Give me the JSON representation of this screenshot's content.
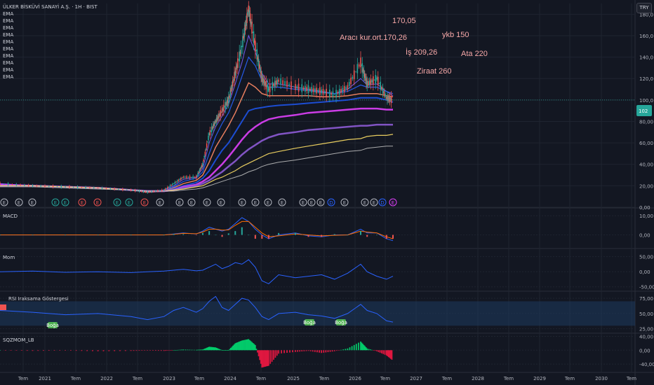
{
  "symbol_title": "ÜLKER BİSKÜVİ SANAYİ A.Ş. · 1H · BIST",
  "currency_button": "TRY",
  "ema_labels": [
    "EMA",
    "EMA",
    "EMA",
    "EMA",
    "EMA",
    "EMA",
    "EMA",
    "EMA",
    "EMA",
    "EMA"
  ],
  "panels": {
    "macd_title": "MACD",
    "mom_title": "Mom",
    "rsi_title": "RSI Iraksama Göstergesi",
    "sqz_title": "SQZMOM_LB"
  },
  "annotations": [
    {
      "id": "a1",
      "text": "170,05"
    },
    {
      "id": "a2",
      "text": "Aracı kur.ort.170,26"
    },
    {
      "id": "a3",
      "text": "ykb 150"
    },
    {
      "id": "a4",
      "text": "İş 209,26"
    },
    {
      "id": "a5",
      "text": "Ata 220"
    },
    {
      "id": "a6",
      "text": "Ziraat 260"
    }
  ],
  "price_badge": "102",
  "rsi_bull_labels": [
    "Boğa",
    "Boğa",
    "Boğa"
  ],
  "rsi_badge": "",
  "colors": {
    "background": "#131722",
    "grid": "#1f2430",
    "macd": "#2962ff",
    "signal": "#ff6d00",
    "momentum": "#2962ff",
    "rsi": "#2962ff",
    "rsi_band": "#1e3a5f",
    "sqz_up": "#00e676",
    "sqz_down": "#ff1744",
    "candle_up": "#26a69a",
    "candle_down": "#ef5350",
    "badge": "#26a69a"
  },
  "chart_data": [
    {
      "type": "line",
      "title": "ÜLKER BİSKÜVİ SANAYİ A.Ş. · 1H · BIST",
      "y_ticks": [
        "0,00",
        "20,00",
        "40,00",
        "60,00",
        "80,00",
        "100,0",
        "120,0",
        "140,0",
        "160,0",
        "180,0"
      ],
      "ylim": [
        0,
        190
      ],
      "x_ticks": [
        "Tem",
        "2021",
        "Tem",
        "2022",
        "Tem",
        "2023",
        "Tem",
        "2024",
        "Tem",
        "2025",
        "Tem",
        "2026",
        "Tem",
        "2027",
        "Tem",
        "2028",
        "Tem",
        "2029",
        "Tem",
        "2030",
        "Tem"
      ],
      "x": [
        2020.5,
        2021.0,
        2021.5,
        2022.0,
        2022.5,
        2022.75,
        2023.0,
        2023.15,
        2023.3,
        2023.5,
        2023.6,
        2023.7,
        2023.8,
        2023.9,
        2024.0,
        2024.1,
        2024.2,
        2024.3,
        2024.4,
        2024.5,
        2024.6,
        2024.75,
        2025.0,
        2025.2,
        2025.4,
        2025.6,
        2025.8,
        2026.0,
        2026.1,
        2026.25,
        2026.4,
        2026.5
      ],
      "series": [
        {
          "role": "price",
          "values": [
            22,
            20,
            19,
            18,
            16,
            14,
            16,
            22,
            28,
            28,
            40,
            68,
            80,
            90,
            100,
            125,
            150,
            185,
            150,
            120,
            110,
            118,
            112,
            110,
            108,
            105,
            112,
            135,
            115,
            120,
            102,
            100
          ]
        },
        {
          "role": "ema-fast",
          "values": [
            22,
            20,
            19,
            18,
            16,
            14,
            16,
            20,
            26,
            28,
            36,
            60,
            75,
            85,
            96,
            115,
            135,
            160,
            145,
            125,
            115,
            115,
            112,
            110,
            108,
            106,
            110,
            120,
            114,
            115,
            108,
            104
          ]
        },
        {
          "role": "ema-2",
          "values": [
            21,
            20,
            19,
            18,
            16,
            14,
            15,
            19,
            24,
            27,
            33,
            50,
            66,
            78,
            88,
            104,
            122,
            140,
            132,
            118,
            112,
            112,
            110,
            109,
            107,
            106,
            108,
            114,
            112,
            112,
            108,
            106
          ]
        },
        {
          "role": "ema-3",
          "values": [
            21,
            20,
            19,
            18,
            16,
            14,
            15,
            18,
            22,
            25,
            30,
            42,
            56,
            66,
            76,
            88,
            102,
            116,
            112,
            106,
            104,
            104,
            104,
            104,
            103,
            103,
            104,
            106,
            106,
            106,
            104,
            103
          ]
        },
        {
          "role": "ema-4",
          "values": [
            21,
            20,
            19,
            18,
            16,
            15,
            15,
            17,
            20,
            23,
            27,
            34,
            44,
            53,
            60,
            70,
            80,
            90,
            92,
            93,
            94,
            95,
            96,
            97,
            98,
            99,
            100,
            102,
            102,
            102,
            100,
            98
          ]
        },
        {
          "role": "ema-5",
          "values": [
            21,
            20,
            19,
            18,
            16,
            15,
            15,
            16,
            19,
            21,
            24,
            28,
            34,
            40,
            47,
            55,
            63,
            70,
            75,
            79,
            82,
            84,
            86,
            88,
            89,
            90,
            91,
            92,
            92,
            92,
            91,
            91
          ]
        },
        {
          "role": "ema-6",
          "values": [
            20,
            20,
            19,
            18,
            16,
            15,
            15,
            16,
            18,
            20,
            22,
            25,
            29,
            33,
            38,
            43,
            49,
            54,
            58,
            62,
            65,
            68,
            70,
            72,
            73,
            74,
            75,
            76,
            76,
            77,
            77,
            77
          ]
        },
        {
          "role": "ema-7",
          "values": [
            20,
            20,
            19,
            18,
            16,
            15,
            15,
            16,
            17,
            19,
            20,
            23,
            26,
            28,
            31,
            34,
            38,
            41,
            44,
            47,
            50,
            52,
            55,
            57,
            59,
            61,
            63,
            64,
            66,
            67,
            67,
            68
          ]
        },
        {
          "role": "ema-8",
          "values": [
            19,
            19,
            18,
            17,
            16,
            15,
            15,
            15,
            16,
            17,
            18,
            20,
            22,
            24,
            26,
            28,
            30,
            33,
            35,
            38,
            40,
            42,
            44,
            46,
            48,
            50,
            52,
            53,
            55,
            56,
            57,
            57
          ]
        }
      ]
    },
    {
      "type": "line",
      "title": "MACD",
      "y_ticks": [
        "10,00",
        "0,00"
      ],
      "ylim": [
        -6,
        13
      ],
      "series": [
        {
          "name": "MACD",
          "values": [
            0,
            0,
            0,
            0,
            0,
            0,
            0,
            0.5,
            1,
            0.5,
            2,
            4,
            3,
            2,
            3,
            6,
            9,
            7,
            3,
            0,
            -2,
            0,
            1,
            -0.5,
            -1,
            0,
            0,
            3,
            1,
            1,
            -2,
            -3
          ]
        },
        {
          "name": "Signal",
          "values": [
            0,
            0,
            0,
            0,
            0,
            0,
            0,
            0.3,
            0.8,
            0.6,
            1.5,
            3,
            3,
            2.5,
            2.6,
            5,
            7,
            7,
            4,
            1,
            -1,
            -0.5,
            0.5,
            0,
            -0.5,
            -0.2,
            0,
            2,
            1.5,
            1,
            -1,
            -2
          ]
        }
      ]
    },
    {
      "type": "line",
      "title": "Mom",
      "y_ticks": [
        "50,00",
        "0,00",
        "-50,00"
      ],
      "ylim": [
        -60,
        70
      ],
      "series": [
        {
          "name": "Mom",
          "values": [
            0,
            2,
            -2,
            0,
            -3,
            0,
            2,
            5,
            8,
            3,
            5,
            15,
            25,
            10,
            18,
            30,
            25,
            40,
            15,
            -30,
            -40,
            -10,
            -20,
            -15,
            -10,
            -25,
            -5,
            25,
            0,
            -15,
            -25,
            -15
          ]
        }
      ]
    },
    {
      "type": "line",
      "title": "RSI Iraksama Göstergesi",
      "y_ticks": [
        "75,00",
        "50,00",
        "25,00"
      ],
      "ylim": [
        20,
        82
      ],
      "series": [
        {
          "name": "RSI",
          "values": [
            55,
            52,
            48,
            50,
            45,
            40,
            45,
            55,
            60,
            52,
            58,
            70,
            78,
            60,
            55,
            65,
            75,
            72,
            60,
            45,
            40,
            50,
            52,
            48,
            46,
            42,
            50,
            65,
            55,
            50,
            38,
            36
          ]
        }
      ]
    },
    {
      "type": "bar",
      "title": "SQZMOM_LB",
      "y_ticks": [
        "40,00",
        "0,00",
        "-40,00"
      ],
      "ylim": [
        -60,
        45
      ],
      "values": [
        0,
        -2,
        -1,
        -3,
        -2,
        -1,
        -2,
        0,
        2,
        1,
        2,
        10,
        8,
        0,
        0,
        20,
        28,
        32,
        15,
        -50,
        -45,
        -10,
        -5,
        -2,
        -8,
        -3,
        5,
        25,
        5,
        -3,
        -15,
        -30
      ]
    }
  ]
}
